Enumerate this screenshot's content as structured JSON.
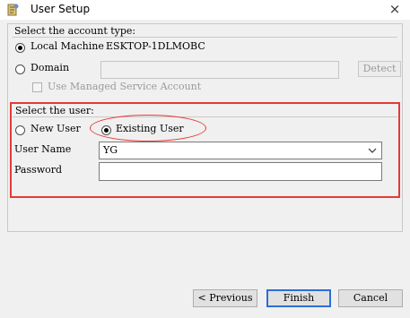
{
  "window": {
    "title": "User Setup",
    "close_glyph": "×",
    "icon": "setup-wizard-icon"
  },
  "account_type": {
    "label": "Select the account type:",
    "local_machine_label": "Local Machine",
    "local_machine_value": "ESKTOP-1DLMOBC",
    "local_machine_selected": true,
    "domain_label": "Domain",
    "domain_value": "",
    "detect_label": "Detect",
    "managed_service_label": "Use Managed Service Account"
  },
  "user": {
    "label": "Select the user:",
    "new_user_label": "New User",
    "existing_user_label": "Existing User",
    "existing_selected": true,
    "user_name_label": "User Name",
    "user_name_value": "YG",
    "password_label": "Password",
    "password_value": ""
  },
  "buttons": {
    "previous": "< Previous",
    "finish": "Finish",
    "cancel": "Cancel"
  },
  "colors": {
    "highlight": "#e53935",
    "default_button_border": "#2b6fd6"
  }
}
